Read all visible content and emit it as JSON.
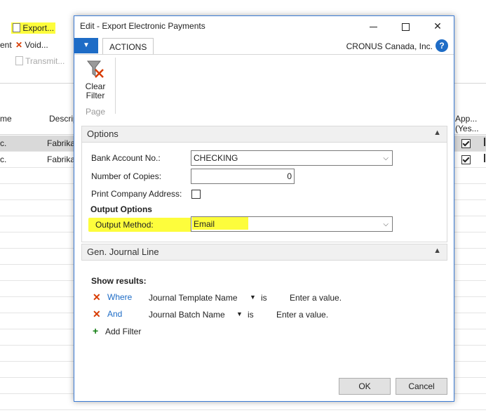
{
  "background": {
    "ribbon": {
      "export_label": "Export...",
      "void_label": "Void...",
      "transmit_label": "Transmit...",
      "left_cut_label": "ent"
    },
    "columns": [
      "me",
      "Descrip",
      "App...",
      "(Yes..."
    ],
    "rows": [
      {
        "c1": "c.",
        "c2": "Fabrika"
      },
      {
        "c1": "c.",
        "c2": "Fabrika"
      }
    ]
  },
  "dialog": {
    "title": "Edit - Export Electronic Payments",
    "tab_actions": "ACTIONS",
    "company": "CRONUS Canada, Inc.",
    "help": "?",
    "clear_filter_label": "Clear Filter",
    "group_page": "Page",
    "options_header": "Options",
    "fields": {
      "bank_account_label": "Bank Account No.:",
      "bank_account_value": "CHECKING",
      "copies_label": "Number of Copies:",
      "copies_value": "0",
      "print_address_label": "Print Company Address:",
      "output_options_label": "Output Options",
      "output_method_label": "Output Method:",
      "output_method_value": "Email"
    },
    "gen_journal_header": "Gen. Journal Line",
    "show_results": "Show results:",
    "filters": [
      {
        "conj": "Where",
        "field": "Journal Template Name",
        "op": "is",
        "value": "Enter a value."
      },
      {
        "conj": "And",
        "field": "Journal Batch Name",
        "op": "is",
        "value": "Enter a value."
      }
    ],
    "add_filter": "Add Filter",
    "ok_label": "OK",
    "cancel_label": "Cancel"
  },
  "colors": {
    "accent": "#1e6cc6",
    "highlight": "#fdfd3c",
    "remove": "#d83b01",
    "add": "#107c10"
  }
}
